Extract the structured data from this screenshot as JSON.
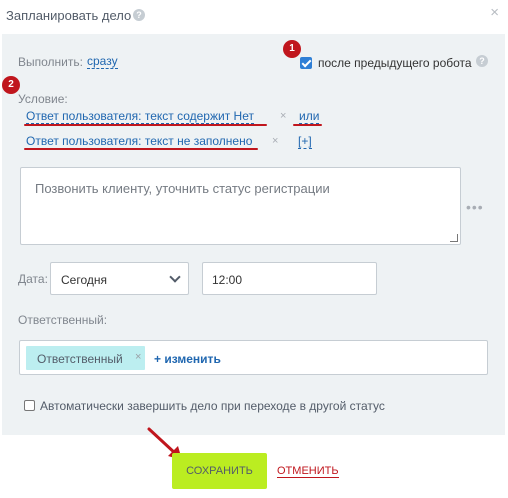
{
  "dialog": {
    "title": "Запланировать дело",
    "help_icon": "question-icon",
    "close_icon": "close-icon"
  },
  "annotations": {
    "marker1": "1",
    "marker2": "2",
    "accent_color": "#c0161d"
  },
  "execute": {
    "label": "Выполнить:",
    "value": "сразу"
  },
  "after_previous": {
    "label": "после предыдущего робота",
    "checked": true
  },
  "condition": {
    "label": "Условие:",
    "rows": [
      {
        "text": "Ответ пользователя: текст   содержит   Нет",
        "remove": "×",
        "operator": "или"
      },
      {
        "text": "Ответ пользователя: текст   не заполнено",
        "remove": "×",
        "add": "[+]"
      }
    ]
  },
  "description": {
    "value": "Позвонить клиенту, уточнить статус регистрации",
    "more_icon": "more-dots-icon"
  },
  "date": {
    "label": "Дата:",
    "selected": "Сегодня",
    "time": "12:00"
  },
  "responsible": {
    "label": "Ответственный:",
    "tag": "Ответственный",
    "tag_remove": "×",
    "change_link": "+ изменить"
  },
  "auto_complete": {
    "label": "Автоматически завершить дело при переходе в другой статус",
    "checked": false
  },
  "footer": {
    "save_label": "СОХРАНИТЬ",
    "cancel_label": "ОТМЕНИТЬ",
    "save_color": "#bbed21"
  }
}
